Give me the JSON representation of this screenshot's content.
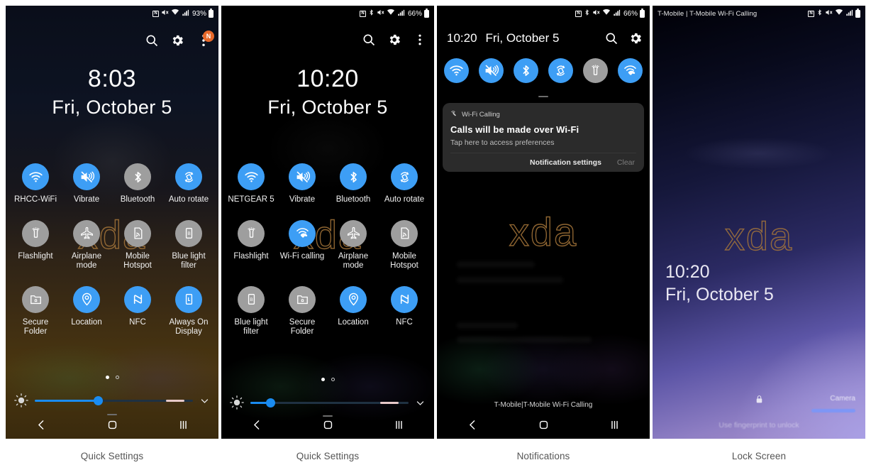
{
  "colors": {
    "tile_on": "#3d9ef5",
    "tile_off": "#9e9e9e",
    "accent_slider": "#1a8cf0",
    "badge": "#e8692a",
    "watermark": "#a6753a",
    "caption_text": "#555555"
  },
  "watermark": "xda",
  "captions": [
    "Quick Settings",
    "Quick Settings",
    "Notifications",
    "Lock Screen"
  ],
  "panels": [
    {
      "id": "quick-settings-1",
      "statusbar": {
        "left": "",
        "icons": [
          "nfc-icon",
          "mute-icon",
          "wifi-icon",
          "signal-icon"
        ],
        "nfc_glyph": "N",
        "battery_percent": "93%"
      },
      "header": {
        "search_label": "search-icon",
        "settings_label": "gear-icon",
        "overflow_label": "overflow-menu-icon",
        "badge_text": "N"
      },
      "clock": {
        "time": "8:03",
        "date": "Fri, October 5"
      },
      "tiles": [
        {
          "label": "RHCC-WiFi",
          "icon": "wifi-icon",
          "state": "on"
        },
        {
          "label": "Vibrate",
          "icon": "vibrate-icon",
          "state": "on"
        },
        {
          "label": "Bluetooth",
          "icon": "bluetooth-icon",
          "state": "off"
        },
        {
          "label": "Auto rotate",
          "icon": "auto-rotate-icon",
          "state": "on"
        },
        {
          "label": "Flashlight",
          "icon": "flashlight-icon",
          "state": "off"
        },
        {
          "label": "Airplane mode",
          "icon": "airplane-icon",
          "state": "off"
        },
        {
          "label": "Mobile Hotspot",
          "icon": "hotspot-icon",
          "state": "off"
        },
        {
          "label": "Blue light filter",
          "icon": "blue-light-icon",
          "state": "off"
        },
        {
          "label": "Secure Folder",
          "icon": "secure-folder-icon",
          "state": "off"
        },
        {
          "label": "Location",
          "icon": "location-icon",
          "state": "on"
        },
        {
          "label": "NFC",
          "icon": "nfc-icon",
          "state": "on"
        },
        {
          "label": "Always On Display",
          "icon": "always-on-icon",
          "state": "on"
        }
      ],
      "pager": {
        "active_index": 0,
        "count": 2
      },
      "brightness": {
        "value_percent": 40,
        "auto_marker": true
      },
      "navbar": [
        "back-icon",
        "home-icon",
        "recents-icon"
      ]
    },
    {
      "id": "quick-settings-2",
      "statusbar": {
        "left": "",
        "icons": [
          "nfc-icon",
          "bluetooth-icon",
          "mute-icon",
          "wifi-icon",
          "signal-icon"
        ],
        "nfc_glyph": "N",
        "battery_percent": "66%"
      },
      "header": {
        "search_label": "search-icon",
        "settings_label": "gear-icon",
        "overflow_label": "overflow-menu-icon",
        "badge_text": ""
      },
      "clock": {
        "time": "10:20",
        "date": "Fri, October 5"
      },
      "tiles": [
        {
          "label": "NETGEAR 5",
          "icon": "wifi-icon",
          "state": "on"
        },
        {
          "label": "Vibrate",
          "icon": "vibrate-icon",
          "state": "on"
        },
        {
          "label": "Bluetooth",
          "icon": "bluetooth-icon",
          "state": "on"
        },
        {
          "label": "Auto rotate",
          "icon": "auto-rotate-icon",
          "state": "on"
        },
        {
          "label": "Flashlight",
          "icon": "flashlight-icon",
          "state": "off"
        },
        {
          "label": "Wi-Fi calling",
          "icon": "wifi-calling-icon",
          "state": "on"
        },
        {
          "label": "Airplane mode",
          "icon": "airplane-icon",
          "state": "off"
        },
        {
          "label": "Mobile Hotspot",
          "icon": "hotspot-icon",
          "state": "off"
        },
        {
          "label": "Blue light filter",
          "icon": "blue-light-icon",
          "state": "off"
        },
        {
          "label": "Secure Folder",
          "icon": "secure-folder-icon",
          "state": "off"
        },
        {
          "label": "Location",
          "icon": "location-icon",
          "state": "on"
        },
        {
          "label": "NFC",
          "icon": "nfc-icon",
          "state": "on"
        }
      ],
      "pager": {
        "active_index": 0,
        "count": 2
      },
      "brightness": {
        "value_percent": 13,
        "auto_marker": true
      },
      "navbar": [
        "back-icon",
        "home-icon",
        "recents-icon"
      ]
    },
    {
      "id": "notifications",
      "statusbar": {
        "left": "",
        "icons": [
          "nfc-icon",
          "bluetooth-icon",
          "mute-icon",
          "wifi-icon",
          "signal-icon"
        ],
        "nfc_glyph": "N",
        "battery_percent": "66%"
      },
      "header": {
        "time": "10:20",
        "date": "Fri, October 5",
        "search_label": "search-icon",
        "settings_label": "gear-icon"
      },
      "quick_icons": [
        {
          "icon": "wifi-icon",
          "state": "on"
        },
        {
          "icon": "vibrate-icon",
          "state": "on"
        },
        {
          "icon": "bluetooth-icon",
          "state": "on"
        },
        {
          "icon": "auto-rotate-icon",
          "state": "on"
        },
        {
          "icon": "flashlight-icon",
          "state": "off"
        },
        {
          "icon": "wifi-calling-icon",
          "state": "on"
        }
      ],
      "notification": {
        "app": "Wi-Fi Calling",
        "app_icon": "wifi-calling-icon",
        "title": "Calls will be made over Wi-Fi",
        "subtitle": "Tap here to access preferences",
        "action_primary": "Notification settings",
        "action_secondary": "Clear"
      },
      "carrier": "T-Mobile|T-Mobile Wi-Fi Calling",
      "navbar": [
        "back-icon",
        "home-icon",
        "recents-icon"
      ]
    },
    {
      "id": "lock-screen",
      "statusbar": {
        "left": "T-Mobile | T-Mobile Wi-Fi Calling",
        "icons": [
          "nfc-icon",
          "bluetooth-icon",
          "mute-icon",
          "wifi-icon",
          "signal-icon"
        ],
        "nfc_glyph": "N",
        "battery_percent": ""
      },
      "clock": {
        "time": "10:20",
        "date": "Fri, October 5"
      },
      "lock_icon": "lock-icon",
      "hint": "Use fingerprint to unlock",
      "camera_label": "Camera"
    }
  ]
}
